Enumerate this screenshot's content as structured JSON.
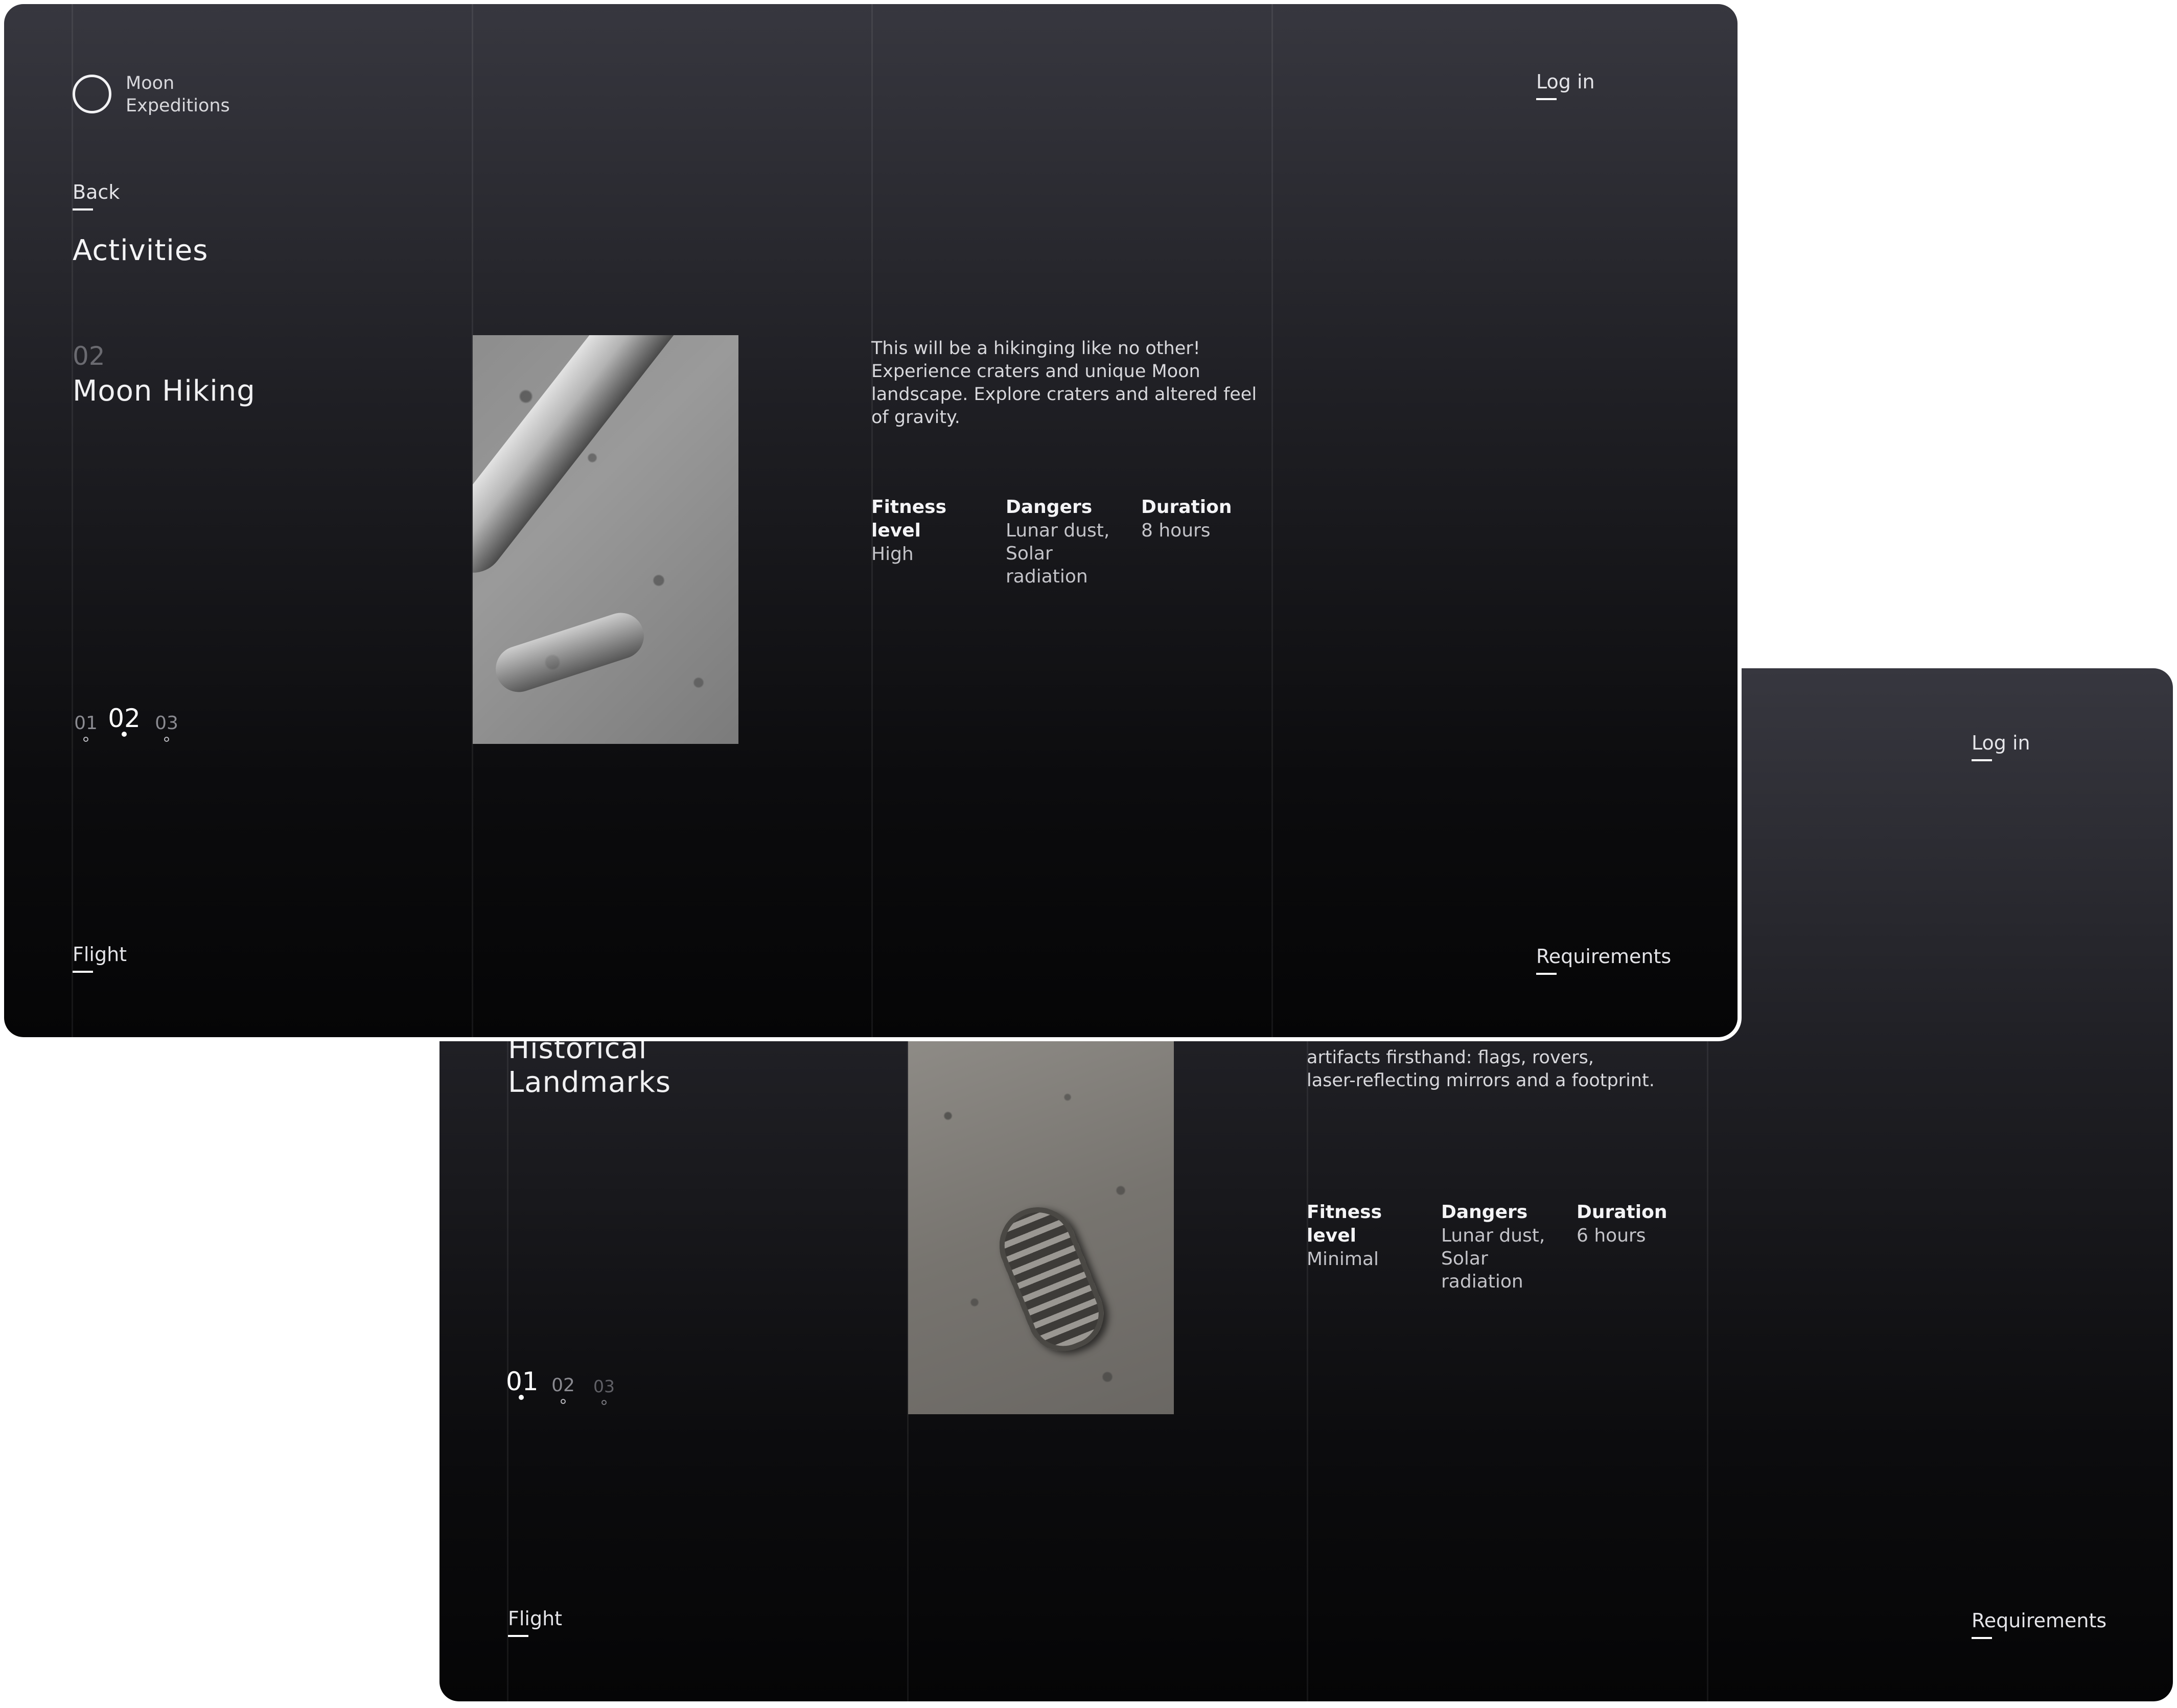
{
  "brand": {
    "line1": "Moon",
    "line2": "Expeditions"
  },
  "front_screen": {
    "login": "Log in",
    "back": "Back",
    "section_title": "Activities",
    "activity_number": "02",
    "activity_title": "Moon Hiking",
    "description": "This will be a hikinging like no other! Experience craters and unique Moon landscape. Explore craters and altered feel of gravity.",
    "stats": [
      {
        "label": "Fitness level",
        "value": "High"
      },
      {
        "label": "Dangers",
        "value": "Lunar dust, Solar radiation"
      },
      {
        "label": "Duration",
        "value": "8 hours"
      }
    ],
    "pager": [
      {
        "label": "01",
        "active": false
      },
      {
        "label": "02",
        "active": true
      },
      {
        "label": "03",
        "active": false
      }
    ],
    "footer_left": "Flight",
    "footer_right": "Requirements",
    "image_icon": "moon-surface-photo"
  },
  "back_screen": {
    "login": "Log in",
    "activity_title_line1": "Historical",
    "activity_title_line2": "Landmarks",
    "description_line1": "artifacts firsthand: flags, rovers,",
    "description_line2": "laser-reflecting mirrors and a footprint.",
    "stats": [
      {
        "label": "Fitness level",
        "value": "Minimal"
      },
      {
        "label": "Dangers",
        "value": "Lunar dust, Solar radiation"
      },
      {
        "label": "Duration",
        "value": "6 hours"
      }
    ],
    "pager": [
      {
        "label": "01",
        "active": true
      },
      {
        "label": "02",
        "active": false
      },
      {
        "label": "03",
        "active": false
      }
    ],
    "footer_left": "Flight",
    "footer_right": "Requirements",
    "image_icon": "footprint-photo"
  }
}
